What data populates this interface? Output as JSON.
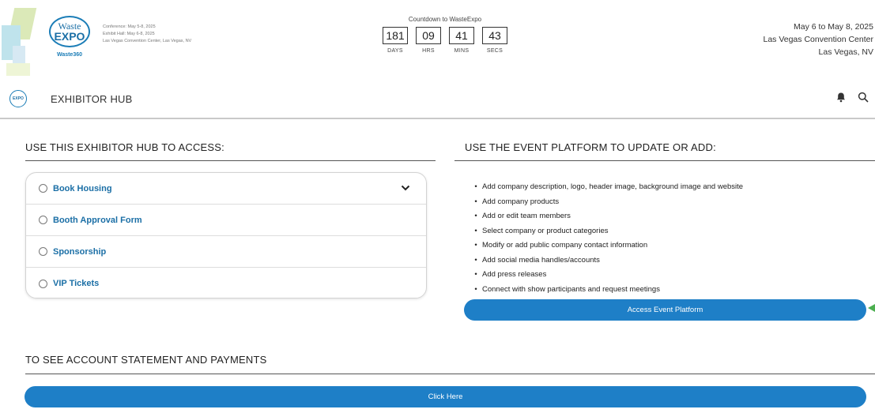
{
  "brand": {
    "logo_line1": "Waste",
    "logo_line2": "EXPO",
    "logo_sub": "Waste360",
    "conference_dates": "Conference: May 5-8, 2025",
    "exhibit_hall_dates": "Exhibit Hall: May 6-8, 2025",
    "venue_line": "Las Vegas Convention Center, Las Vegas, NV"
  },
  "countdown": {
    "title": "Countdown to WasteExpo",
    "days": "181",
    "hrs": "09",
    "mins": "41",
    "secs": "43",
    "days_label": "DAYS",
    "hrs_label": "HRS",
    "mins_label": "MINS",
    "secs_label": "SECS"
  },
  "event": {
    "dates": "May 6 to May 8, 2025",
    "venue": "Las Vegas Convention Center",
    "city": "Las Vegas, NV"
  },
  "nav": {
    "logo_text": "EXPO",
    "title": "EXHIBITOR HUB",
    "icons": [
      "bell-icon",
      "search-icon"
    ]
  },
  "hub": {
    "heading": "USE THIS EXHIBITOR HUB TO ACCESS:",
    "items": [
      {
        "label": "Book Housing"
      },
      {
        "label": "Booth Approval Form"
      },
      {
        "label": "Sponsorship"
      },
      {
        "label": "VIP Tickets"
      }
    ]
  },
  "platform": {
    "heading": "USE THE EVENT PLATFORM TO UPDATE OR ADD:",
    "bullets": [
      "Add company description, logo, header image, background image and website",
      "Add company products",
      "Add or edit team members",
      "Select company or product categories",
      "Modify or add public company contact information",
      "Add social media handles/accounts",
      "Add press releases",
      "Connect with show participants and request meetings"
    ],
    "button_label": "Access Event Platform"
  },
  "account": {
    "heading": "TO SEE ACCOUNT STATEMENT AND PAYMENTS",
    "button_label": "Click Here"
  },
  "colors": {
    "accent": "#1e7fc7",
    "link": "#1b6fa6",
    "pointer": "#4caf50"
  }
}
